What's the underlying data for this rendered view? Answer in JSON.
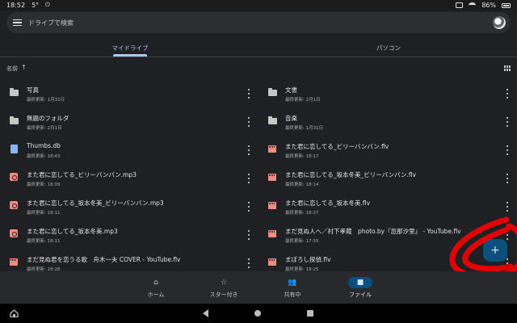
{
  "status_bar": {
    "time": "18:52",
    "temperature": "5°",
    "battery": "86%"
  },
  "search": {
    "placeholder": "ドライブで検索"
  },
  "tabs": [
    {
      "label": "マイドライブ",
      "active": true
    },
    {
      "label": "パソコン",
      "active": false
    }
  ],
  "sort": {
    "label": "名前",
    "direction": "ascending"
  },
  "files": [
    {
      "name": "写真",
      "meta": "最終更新: 1月31日",
      "type": "folder"
    },
    {
      "name": "文書",
      "meta": "最終更新: 2月1日",
      "type": "folder"
    },
    {
      "name": "無題のフォルダ",
      "meta": "最終更新: 2月1日",
      "type": "folder"
    },
    {
      "name": "音楽",
      "meta": "最終更新: 1月31日",
      "type": "folder"
    },
    {
      "name": "Thumbs.db",
      "meta": "最終更新: 18:43",
      "type": "doc"
    },
    {
      "name": "また君に恋してる_ビリーバンバン.flv",
      "meta": "最終更新: 18:17",
      "type": "video"
    },
    {
      "name": "また君に恋してる_ビリーバンバン.mp3",
      "meta": "最終更新: 18:09",
      "type": "audio"
    },
    {
      "name": "また君に恋してる_坂本冬美_ビリーバンバン.flv",
      "meta": "最終更新: 18:14",
      "type": "video"
    },
    {
      "name": "また君に恋してる_坂本冬美_ビリーバンバン.mp3",
      "meta": "最終更新: 18:11",
      "type": "audio"
    },
    {
      "name": "また君に恋してる_坂本冬美.flv",
      "meta": "最終更新: 18:27",
      "type": "video"
    },
    {
      "name": "また君に恋してる_坂本冬美.mp3",
      "meta": "最終更新: 18:11",
      "type": "audio"
    },
    {
      "name": "まだ見ぬ人へ／村下孝蔵　photo.by『忽那汐里』 - YouTube.flv",
      "meta": "最終更新: 17:55",
      "type": "video"
    },
    {
      "name": "まだ見ぬ君を恋うる歌　舟木一夫 COVER - YouTube.flv",
      "meta": "最終更新: 18:28",
      "type": "video"
    },
    {
      "name": "まぼろし探偵.flv",
      "meta": "最終更新: 18:25",
      "type": "video"
    }
  ],
  "bottom_nav": [
    {
      "label": "ホーム",
      "icon": "home-icon",
      "active": false
    },
    {
      "label": "スター付き",
      "icon": "star-icon",
      "active": false
    },
    {
      "label": "共有中",
      "icon": "people-icon",
      "active": false
    },
    {
      "label": "ファイル",
      "icon": "folder-icon",
      "active": true
    }
  ],
  "fab": {
    "symbol": "+",
    "icon": "plus-icon"
  },
  "colors": {
    "background": "#1f2023",
    "accent": "#a8c7fa",
    "fab": "#0b4f7d",
    "annotation": "#e00000"
  }
}
